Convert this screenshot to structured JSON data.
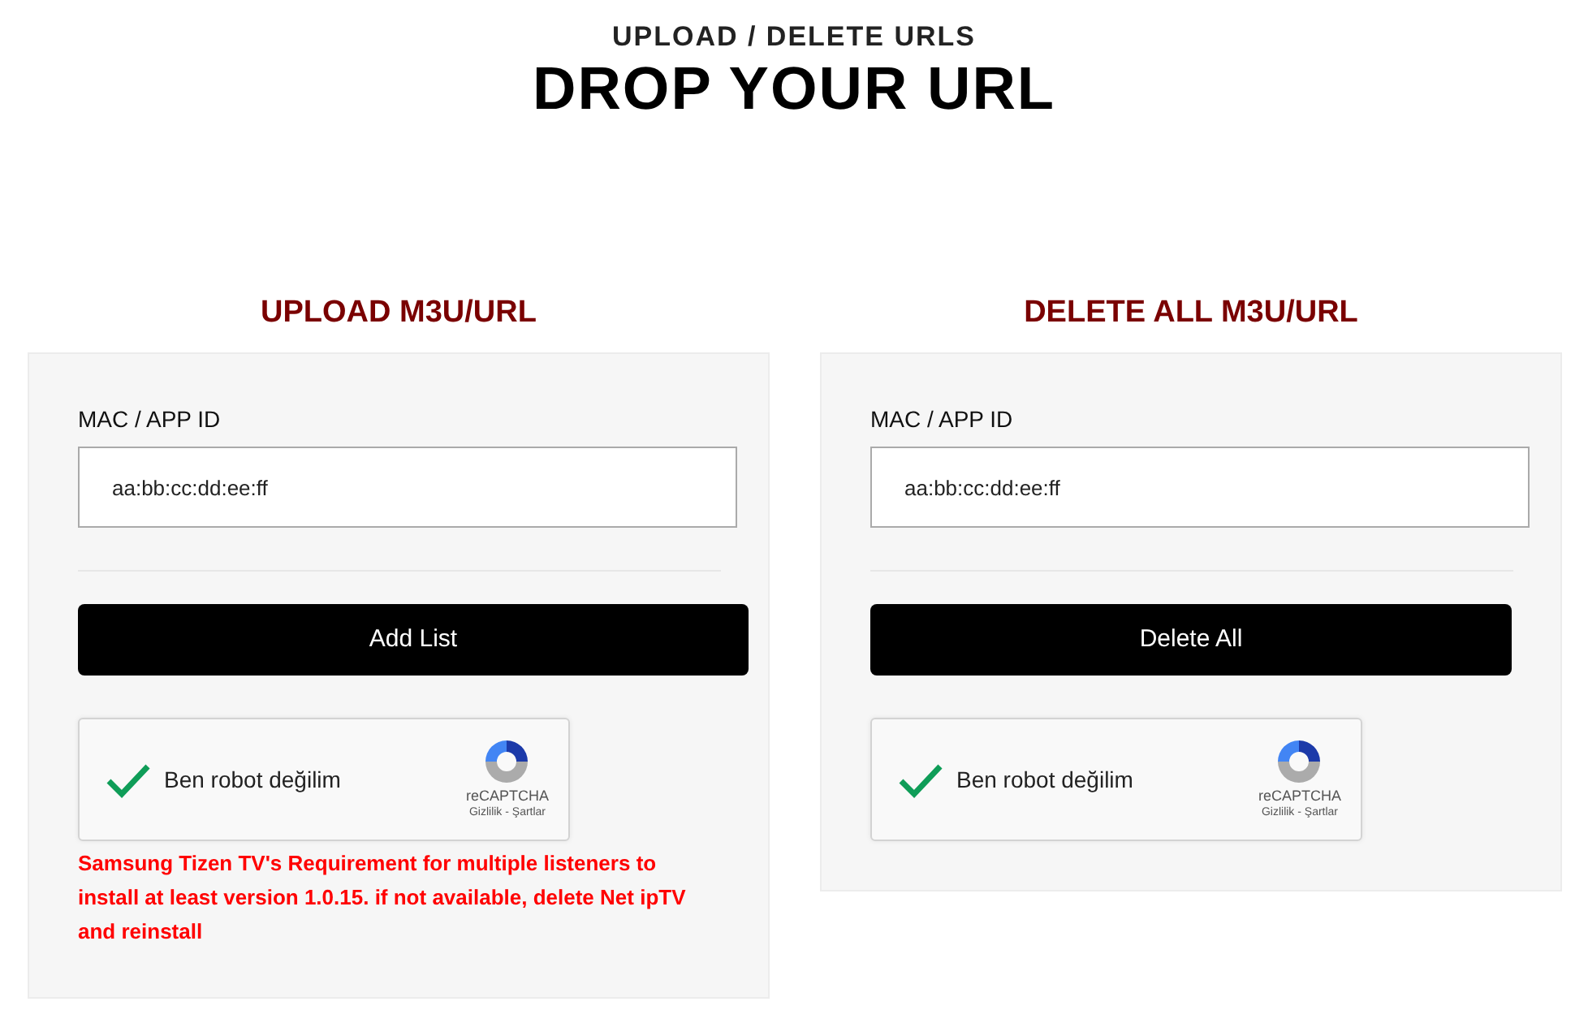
{
  "header": {
    "subtitle": "UPLOAD / DELETE URLS",
    "title": "DROP YOUR URL"
  },
  "panels": [
    {
      "heading": "UPLOAD M3U/URL",
      "field_label": "MAC / APP ID",
      "value": "aa:bb:cc:dd:ee:ff",
      "button": "Add List",
      "captcha": {
        "label": "Ben robot değilim",
        "checked": true,
        "brand": "reCAPTCHA",
        "links": "Gizlilik - Şartlar"
      },
      "notice": "Samsung Tizen TV's Requirement for multiple listeners to install at least version 1.0.15. if not available, delete Net ipTV and reinstall"
    },
    {
      "heading": "DELETE ALL M3U/URL",
      "field_label": "MAC / APP ID",
      "value": "aa:bb:cc:dd:ee:ff",
      "button": "Delete All",
      "captcha": {
        "label": "Ben robot değilim",
        "checked": true,
        "brand": "reCAPTCHA",
        "links": "Gizlilik - Şartlar"
      }
    }
  ]
}
